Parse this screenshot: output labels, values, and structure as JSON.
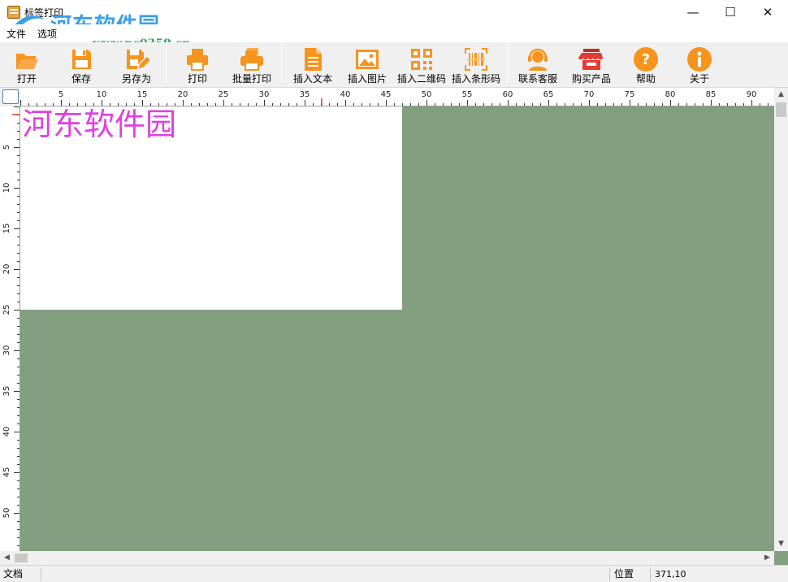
{
  "window": {
    "title": "标签打印",
    "controls": [
      "minimize-icon",
      "maximize-icon",
      "close-icon"
    ]
  },
  "watermark": {
    "main": "河东软件园",
    "sub": "www.pc0359.cn"
  },
  "menu": [
    {
      "label": "文件"
    },
    {
      "label": "选项"
    }
  ],
  "toolbar": [
    {
      "id": "open",
      "label": "打开",
      "icon": "folder-open-icon"
    },
    {
      "id": "save",
      "label": "保存",
      "icon": "save-icon"
    },
    {
      "id": "save-as",
      "label": "另存为",
      "icon": "save-as-icon"
    },
    {
      "id": "print",
      "label": "打印",
      "icon": "printer-icon"
    },
    {
      "id": "batch-print",
      "label": "批量打印",
      "icon": "batch-printer-icon"
    },
    {
      "id": "insert-text",
      "label": "插入文本",
      "icon": "document-icon"
    },
    {
      "id": "insert-image",
      "label": "插入图片",
      "icon": "image-icon"
    },
    {
      "id": "insert-qrcode",
      "label": "插入二维码",
      "icon": "qrcode-icon"
    },
    {
      "id": "insert-barcode",
      "label": "插入条形码",
      "icon": "barcode-icon"
    },
    {
      "id": "contact-support",
      "label": "联系客服",
      "icon": "headset-icon"
    },
    {
      "id": "buy-product",
      "label": "购买产品",
      "icon": "shop-icon"
    },
    {
      "id": "help",
      "label": "帮助",
      "icon": "question-icon"
    },
    {
      "id": "about",
      "label": "关于",
      "icon": "info-icon"
    }
  ],
  "ruler": {
    "h_labels": [
      "5",
      "10",
      "15",
      "20",
      "25",
      "30",
      "35",
      "40",
      "45",
      "50",
      "55",
      "60",
      "65",
      "70",
      "75",
      "80",
      "85",
      "90"
    ],
    "v_labels": [
      "5",
      "10",
      "15",
      "20",
      "25",
      "30",
      "35",
      "40",
      "45",
      "50"
    ]
  },
  "canvas": {
    "label_text": "河东软件园",
    "workspace_color": "#82a07f",
    "text_color": "#e040e0"
  },
  "status": {
    "doc_label": "文档",
    "position_label": "位置",
    "position_value": "371,10"
  },
  "colors": {
    "accent_orange": "#f7941d",
    "buy_red": "#e53935"
  }
}
